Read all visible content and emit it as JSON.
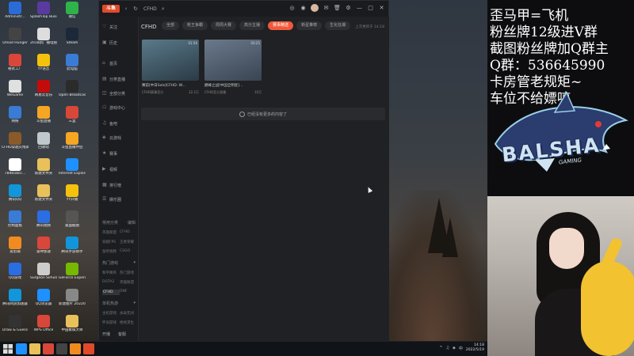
{
  "desktop": {
    "icons": [
      {
        "label": "Administr...",
        "color": "#2a6bd6"
      },
      {
        "label": "SplashTop Business",
        "color": "#5a3aa0"
      },
      {
        "label": "微信",
        "color": "#2db34a"
      },
      {
        "label": "Dread Hunger",
        "color": "#444444"
      },
      {
        "label": "2018新广播电视编辑...",
        "color": "#dddddd"
      },
      {
        "label": "Steam",
        "color": "#1b2838"
      },
      {
        "label": "格式工厂",
        "color": "#d9473a"
      },
      {
        "label": "YY语音",
        "color": "#f4c20d"
      },
      {
        "label": "此电脑",
        "color": "#3a7bd5"
      },
      {
        "label": "WeGame",
        "color": "#e0e0e0"
      },
      {
        "label": "网易云音乐",
        "color": "#c20c0c"
      },
      {
        "label": "Open Broadcast...",
        "color": "#2b2b2b"
      },
      {
        "label": "网络",
        "color": "#3a7bd5"
      },
      {
        "label": "斗鱼直播",
        "color": "#f5a623"
      },
      {
        "label": "三里",
        "color": "#d9473a"
      },
      {
        "label": "CFHD穿越火线高清",
        "color": "#8a5a2a"
      },
      {
        "label": "回收站",
        "color": "#bfc7cf"
      },
      {
        "label": "斗鱼直播伴侣",
        "color": "#f5a623"
      },
      {
        "label": "784658cc...",
        "color": "#ffffff"
      },
      {
        "label": "新建文件夹",
        "color": "#e8c15a"
      },
      {
        "label": "Internet Explorer",
        "color": "#1e90ff"
      },
      {
        "label": "腾讯QQ",
        "color": "#1296db"
      },
      {
        "label": "新建文件夹",
        "color": "#e8c15a"
      },
      {
        "label": "YY开播",
        "color": "#f4c20d"
      },
      {
        "label": "控制面板",
        "color": "#3a7bd5"
      },
      {
        "label": "腾讯视频",
        "color": "#2b6de3"
      },
      {
        "label": "桌面截图",
        "color": "#555555"
      },
      {
        "label": "爱剪辑",
        "color": "#f28b1f"
      },
      {
        "label": "雷神加速",
        "color": "#d9473a"
      },
      {
        "label": "腾讯手游助手",
        "color": "#1296db"
      },
      {
        "label": "QQ游戏",
        "color": "#2b6de3"
      },
      {
        "label": "Surgeon Simulator 2",
        "color": "#cccccc"
      },
      {
        "label": "GeForce Experience",
        "color": "#76b900"
      },
      {
        "label": "腾讯网游加速器",
        "color": "#1296db"
      },
      {
        "label": "QQ浏览器",
        "color": "#1e90ff"
      },
      {
        "label": "新建图片 2022050...",
        "color": "#888888"
      },
      {
        "label": "Draw & Guess",
        "color": "#333333"
      },
      {
        "label": "WPS Office",
        "color": "#d9473a"
      },
      {
        "label": "中国象棋大师",
        "color": "#e8c15a"
      }
    ]
  },
  "app": {
    "logo_text": "斗鱼",
    "window_title": "CFHD",
    "nav_back": "‹",
    "nav_refresh": "↻",
    "search_glyph": "⌕",
    "title_icons": [
      "◎",
      "◉",
      "☺",
      "✉",
      "🗑",
      "⚙",
      "—",
      "□",
      "✕"
    ],
    "sidebar": {
      "top": [
        {
          "icon": "♡",
          "label": "关注"
        },
        {
          "icon": "▣",
          "label": "历史"
        },
        {
          "icon": "⌂",
          "label": "首页"
        },
        {
          "icon": "▤",
          "label": "分类直播"
        },
        {
          "icon": "◫",
          "label": "全部分类"
        },
        {
          "icon": "☖",
          "label": "游戏中心"
        },
        {
          "icon": "♫",
          "label": "鱼吧"
        },
        {
          "icon": "◈",
          "label": "云游戏"
        },
        {
          "icon": "★",
          "label": "赛事"
        },
        {
          "icon": "▶",
          "label": "视频"
        },
        {
          "icon": "▦",
          "label": "排行榜"
        },
        {
          "icon": "☰",
          "label": "娱乐圈"
        }
      ],
      "section1": {
        "title": "常用分类",
        "action": "编辑"
      },
      "grid1": [
        "英雄联盟",
        "CFHD",
        "穿越FPS",
        "王者荣耀",
        "鱼吧视频",
        "CSGO"
      ],
      "section2": {
        "title": "热门游戏",
        "action": "▾"
      },
      "grid2": [
        "和平精英",
        "热门游戏",
        "DOTA2",
        "英雄联盟",
        "CFHD",
        "DNF"
      ],
      "section3": {
        "title": "单机热游",
        "action": "▾"
      },
      "grid3": [
        "主机游戏",
        "永劫无间",
        "怀旧游戏",
        "绝地求生"
      ],
      "bottom": [
        "开播",
        "客服"
      ]
    },
    "main": {
      "title": "CFHD",
      "tabs": [
        {
          "label": "全部",
          "active": false
        },
        {
          "label": "枪王争霸",
          "active": false
        },
        {
          "label": "周周大赛",
          "active": false
        },
        {
          "label": "高分主播",
          "active": false
        },
        {
          "label": "赛事精选",
          "active": true
        },
        {
          "label": "新星推荐",
          "active": false
        },
        {
          "label": "生化狂潮",
          "active": false
        }
      ],
      "update_note": "上次更新于 14:18",
      "cards": [
        {
          "title": "赛前[中日Solo]CFHD: W...",
          "duration": "01:56",
          "meta_left": "CFHD赛事官方",
          "meta_right": "22.2万",
          "thumb_color1": "#5a7a8a",
          "thumb_color2": "#2a3a44"
        },
        {
          "title": "巅峰之战[中国全明星]...",
          "duration": "03:25",
          "meta_left": "CFHD官方直播",
          "meta_right": "10万",
          "thumb_color1": "#6a7a8c",
          "thumb_color2": "#3a4452"
        }
      ],
      "empty_text": "已经没有更多的内容了"
    }
  },
  "overlay": {
    "lines": [
      "歪马甲=飞机",
      "粉丝牌12级进V群",
      "截图粉丝牌加Q群主",
      "Q群：536645990",
      "卡房管老规矩~",
      "车位不给嫖哼"
    ],
    "logo_text": "BALSHA",
    "logo_sub": "GAMING"
  },
  "taskbar": {
    "apps": [
      "#1e90ff",
      "#e8c15a",
      "#d9473a",
      "#444444",
      "#f28b1f",
      "#e04a2a"
    ],
    "tray": [
      "^",
      "♫",
      "◈",
      "中"
    ],
    "time": "14:18",
    "date": "2022/5/19"
  }
}
